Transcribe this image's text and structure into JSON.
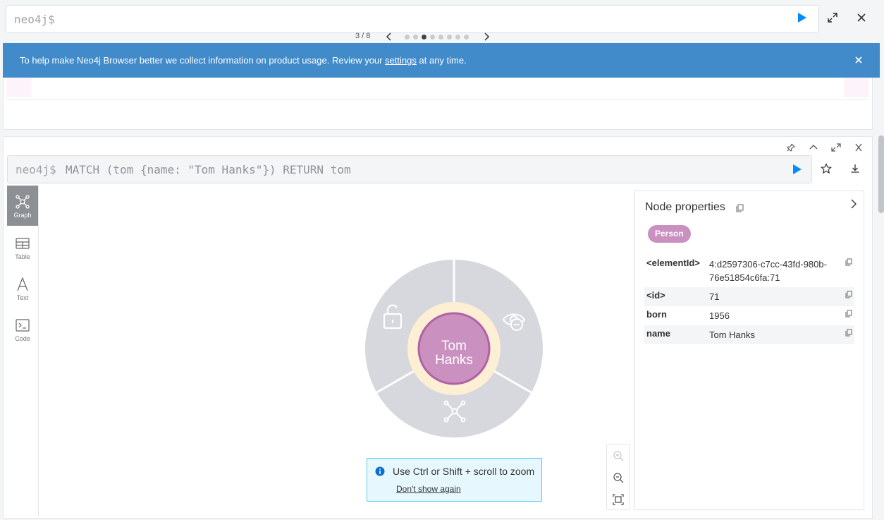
{
  "top_editor": {
    "prompt": "neo4j$"
  },
  "banner": {
    "text_before": "To help make Neo4j Browser better we collect information on product usage. Review your ",
    "link": "settings",
    "text_after": " at any time."
  },
  "carousel": {
    "counter": "3 / 8",
    "total_dots": 8,
    "active_dot": 3
  },
  "frame": {
    "prompt": "neo4j$",
    "query": "MATCH (tom {name: \"Tom Hanks\"}) RETURN tom"
  },
  "tabs": [
    {
      "label": "Graph",
      "icon": "graph-icon",
      "active": true
    },
    {
      "label": "Table",
      "icon": "table-icon",
      "active": false
    },
    {
      "label": "Text",
      "icon": "text-icon",
      "active": false
    },
    {
      "label": "Code",
      "icon": "code-icon",
      "active": false
    }
  ],
  "node": {
    "line1": "Tom",
    "line2": "Hanks",
    "fill": "#c990c0",
    "stroke": "#b261a5"
  },
  "zoom_hint": {
    "message": "Use Ctrl or Shift + scroll to zoom",
    "dismiss": "Don't show again"
  },
  "properties": {
    "title": "Node properties",
    "label": "Person",
    "rows": [
      {
        "key": "<elementId>",
        "value": "4:d2597306-c7cc-43fd-980b-76e51854c6fa:71"
      },
      {
        "key": "<id>",
        "value": "71"
      },
      {
        "key": "born",
        "value": "1956"
      },
      {
        "key": "name",
        "value": "Tom Hanks"
      }
    ]
  },
  "colors": {
    "accent": "#018bff",
    "banner": "#428bca",
    "label": "#c990c0"
  }
}
